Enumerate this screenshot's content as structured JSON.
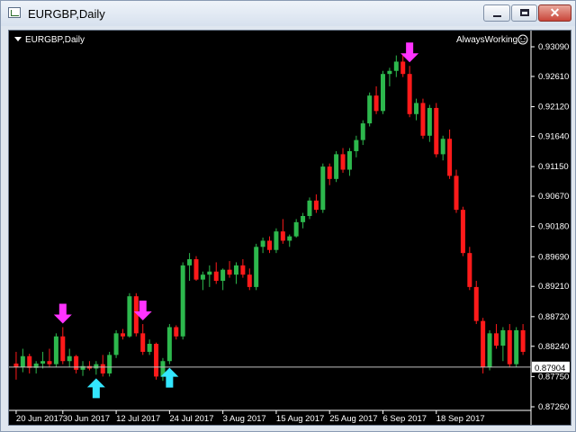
{
  "window": {
    "title": "EURGBP,Daily",
    "buttons": {
      "minimize": "minimize",
      "maximize": "maximize",
      "close": "close"
    },
    "close_glyph": "✕"
  },
  "chart": {
    "symbol_label": "EURGBP,Daily",
    "expert_label": "AlwaysWorking",
    "colors": {
      "background": "#000000",
      "bull": "#2db84d",
      "bear": "#ff1a1a",
      "buy_arrow": "#33e6ff",
      "sell_arrow": "#ff33ff",
      "text": "#ffffff",
      "price_line": "#c0c0c0"
    }
  },
  "chart_data": {
    "type": "candlestick",
    "price_axis_ticks": [
      "0.93090",
      "0.92610",
      "0.92120",
      "0.91640",
      "0.91150",
      "0.90670",
      "0.90180",
      "0.89690",
      "0.89210",
      "0.88720",
      "0.88240",
      "0.87750",
      "0.87260"
    ],
    "time_axis_ticks": [
      "20 Jun 2017",
      "30 Jun 2017",
      "12 Jul 2017",
      "24 Jul 2017",
      "3 Aug 2017",
      "15 Aug 2017",
      "25 Aug 2017",
      "6 Sep 2017",
      "18 Sep 2017"
    ],
    "current_price": "0.87904",
    "ylim": [
      0.8726,
      0.9309
    ],
    "candles": [
      [
        0.8796,
        0.8815,
        0.877,
        0.879
      ],
      [
        0.879,
        0.882,
        0.8782,
        0.8808
      ],
      [
        0.8808,
        0.8812,
        0.878,
        0.8789
      ],
      [
        0.8789,
        0.88,
        0.878,
        0.8796
      ],
      [
        0.8796,
        0.8815,
        0.8788,
        0.88
      ],
      [
        0.88,
        0.882,
        0.879,
        0.8795
      ],
      [
        0.8795,
        0.8845,
        0.879,
        0.884
      ],
      [
        0.884,
        0.8855,
        0.8795,
        0.88
      ],
      [
        0.88,
        0.882,
        0.879,
        0.8808
      ],
      [
        0.8808,
        0.881,
        0.878,
        0.8786
      ],
      [
        0.8786,
        0.88,
        0.8776,
        0.8792
      ],
      [
        0.8792,
        0.88,
        0.8785,
        0.8788
      ],
      [
        0.8788,
        0.88,
        0.8778,
        0.8795
      ],
      [
        0.8795,
        0.881,
        0.8775,
        0.878
      ],
      [
        0.878,
        0.8815,
        0.8775,
        0.881
      ],
      [
        0.881,
        0.885,
        0.8805,
        0.8845
      ],
      [
        0.8845,
        0.8852,
        0.8835,
        0.884
      ],
      [
        0.884,
        0.891,
        0.8838,
        0.8905
      ],
      [
        0.8905,
        0.891,
        0.884,
        0.8845
      ],
      [
        0.8845,
        0.886,
        0.881,
        0.8815
      ],
      [
        0.8815,
        0.8835,
        0.881,
        0.8828
      ],
      [
        0.8828,
        0.883,
        0.877,
        0.8775
      ],
      [
        0.8775,
        0.8805,
        0.8768,
        0.88
      ],
      [
        0.88,
        0.886,
        0.8795,
        0.8855
      ],
      [
        0.8855,
        0.8858,
        0.8835,
        0.884
      ],
      [
        0.884,
        0.896,
        0.8835,
        0.8955
      ],
      [
        0.8955,
        0.8975,
        0.893,
        0.8965
      ],
      [
        0.8965,
        0.897,
        0.893,
        0.8932
      ],
      [
        0.8932,
        0.8945,
        0.8915,
        0.894
      ],
      [
        0.894,
        0.8955,
        0.892,
        0.8945
      ],
      [
        0.8945,
        0.896,
        0.8925,
        0.893
      ],
      [
        0.893,
        0.895,
        0.8915,
        0.8948
      ],
      [
        0.8948,
        0.8962,
        0.8935,
        0.894
      ],
      [
        0.894,
        0.896,
        0.8925,
        0.8955
      ],
      [
        0.8955,
        0.8965,
        0.8935,
        0.894
      ],
      [
        0.894,
        0.895,
        0.8915,
        0.892
      ],
      [
        0.892,
        0.899,
        0.8915,
        0.8985
      ],
      [
        0.8985,
        0.9,
        0.8975,
        0.8995
      ],
      [
        0.8995,
        0.9002,
        0.8975,
        0.898
      ],
      [
        0.898,
        0.9015,
        0.8975,
        0.901
      ],
      [
        0.901,
        0.903,
        0.899,
        0.8995
      ],
      [
        0.8995,
        0.9005,
        0.8985,
        0.9002
      ],
      [
        0.9002,
        0.903,
        0.9,
        0.9025
      ],
      [
        0.9025,
        0.904,
        0.9015,
        0.9035
      ],
      [
        0.9035,
        0.9065,
        0.903,
        0.906
      ],
      [
        0.906,
        0.907,
        0.904,
        0.9045
      ],
      [
        0.9045,
        0.912,
        0.904,
        0.9115
      ],
      [
        0.9115,
        0.912,
        0.9085,
        0.9095
      ],
      [
        0.9095,
        0.914,
        0.909,
        0.9135
      ],
      [
        0.9135,
        0.9145,
        0.9105,
        0.911
      ],
      [
        0.911,
        0.9145,
        0.91,
        0.914
      ],
      [
        0.914,
        0.9165,
        0.913,
        0.9158
      ],
      [
        0.9158,
        0.919,
        0.915,
        0.9185
      ],
      [
        0.9185,
        0.9235,
        0.918,
        0.923
      ],
      [
        0.923,
        0.9245,
        0.92,
        0.9205
      ],
      [
        0.9205,
        0.927,
        0.92,
        0.9265
      ],
      [
        0.9265,
        0.9275,
        0.9245,
        0.927
      ],
      [
        0.927,
        0.9295,
        0.926,
        0.9285
      ],
      [
        0.9285,
        0.9295,
        0.926,
        0.9265
      ],
      [
        0.9265,
        0.9278,
        0.9195,
        0.92
      ],
      [
        0.92,
        0.9225,
        0.919,
        0.9218
      ],
      [
        0.9218,
        0.9225,
        0.916,
        0.9165
      ],
      [
        0.9165,
        0.9215,
        0.9155,
        0.921
      ],
      [
        0.921,
        0.9218,
        0.913,
        0.9135
      ],
      [
        0.9135,
        0.9165,
        0.9125,
        0.916
      ],
      [
        0.916,
        0.9175,
        0.9095,
        0.91
      ],
      [
        0.91,
        0.911,
        0.904,
        0.9045
      ],
      [
        0.9045,
        0.905,
        0.897,
        0.8975
      ],
      [
        0.8975,
        0.8985,
        0.8915,
        0.892
      ],
      [
        0.892,
        0.893,
        0.886,
        0.8865
      ],
      [
        0.8865,
        0.887,
        0.878,
        0.879
      ],
      [
        0.879,
        0.885,
        0.8785,
        0.8845
      ],
      [
        0.8845,
        0.886,
        0.882,
        0.8825
      ],
      [
        0.8825,
        0.8855,
        0.88,
        0.885
      ],
      [
        0.885,
        0.886,
        0.879,
        0.8795
      ],
      [
        0.8795,
        0.8855,
        0.879,
        0.885
      ],
      [
        0.885,
        0.886,
        0.881,
        0.8815
      ]
    ],
    "signals": [
      {
        "type": "sell",
        "index": 7
      },
      {
        "type": "buy",
        "index": 12
      },
      {
        "type": "sell",
        "index": 19
      },
      {
        "type": "buy",
        "index": 23
      },
      {
        "type": "sell",
        "index": 59
      }
    ]
  }
}
